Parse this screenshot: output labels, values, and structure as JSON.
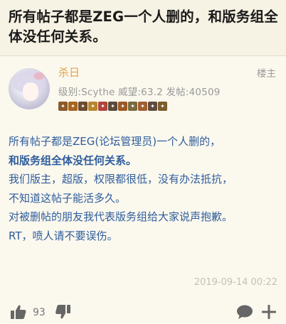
{
  "thread": {
    "title": "所有帖子都是ZEG一个人删的，和版务组全体没任何关系。"
  },
  "post": {
    "username": "杀日",
    "floor_label": "楼主",
    "user_meta": "级别:Scythe 威望:63.2 发帖:40509",
    "medals": [
      {
        "icon": "medal-sword",
        "color": "#8a5a2b"
      },
      {
        "icon": "medal-star",
        "color": "#a7651f"
      },
      {
        "icon": "medal-shield",
        "color": "#6d4c2f"
      },
      {
        "icon": "medal-coin",
        "color": "#b8862d"
      },
      {
        "icon": "medal-heart",
        "color": "#b0453c"
      },
      {
        "icon": "medal-book",
        "color": "#5a4a3a"
      },
      {
        "icon": "medal-axe",
        "color": "#9b5a26"
      },
      {
        "icon": "medal-bow",
        "color": "#7a6a3d"
      },
      {
        "icon": "medal-potion",
        "color": "#a25d2f"
      },
      {
        "icon": "medal-gem",
        "color": "#5f4b3e"
      },
      {
        "icon": "medal-crown",
        "color": "#7c5b2c"
      }
    ],
    "content": [
      {
        "text": "所有帖子都是ZEG(论坛管理员)一个人删的，",
        "bold": false
      },
      {
        "text": "和版务组全体没任何关系。",
        "bold": true
      },
      {
        "text": "我们版主，超版，权限都很低，没有办法抵抗，",
        "bold": false
      },
      {
        "text": "不知道这帖子能活多久。",
        "bold": false
      },
      {
        "text": "对被删帖的朋友我代表版务组给大家说声抱歉。",
        "bold": false
      },
      {
        "text": "RT，喷人请不要误伤。",
        "bold": false
      }
    ],
    "timestamp": "2019-09-14 00:22",
    "like_count": "93"
  },
  "colors": {
    "background": "#f6f2e4",
    "username": "#e3a14a",
    "body_text": "#2f5d9c",
    "muted": "#999999"
  }
}
